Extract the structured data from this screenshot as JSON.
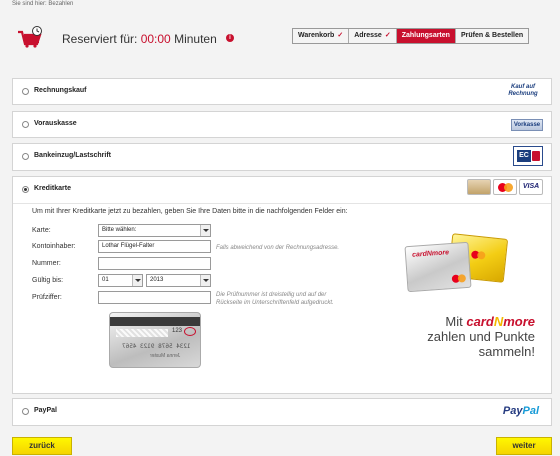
{
  "breadcrumb": "Sie sind hier: Bezahlen",
  "reservation": {
    "prefix": "Reserviert für:",
    "time": "00:00",
    "suffix": "Minuten",
    "info_symbol": "i"
  },
  "steps": [
    {
      "label": "Warenkorb",
      "check": "✓",
      "active": false
    },
    {
      "label": "Adresse",
      "check": "✓",
      "active": false
    },
    {
      "label": "Zahlungsarten",
      "check": "",
      "active": true
    },
    {
      "label": "Prüfen & Bestellen",
      "check": "",
      "active": false
    }
  ],
  "payment_options": {
    "rechnungskauf": {
      "label": "Rechnungskauf",
      "logo_line1": "Kauf auf",
      "logo_line2": "Rechnung"
    },
    "vorauskasse": {
      "label": "Vorauskasse",
      "logo": "Vorkasse"
    },
    "bankeinzug": {
      "label": "Bankeinzug/Lastschrift",
      "logo": "EC"
    },
    "kreditkarte": {
      "label": "Kreditkarte",
      "logos": [
        "",
        "MasterCard",
        "VISA"
      ]
    },
    "paypal": {
      "label": "PayPal",
      "logo_part1": "Pay",
      "logo_part2": "Pal"
    }
  },
  "creditcard_form": {
    "intro": "Um mit Ihrer Kreditkarte jetzt zu bezahlen, geben Sie Ihre Daten bitte in die nachfolgenden Felder ein:",
    "card_label": "Karte:",
    "card_value": "Bitte wählen:",
    "holder_label": "Kontoinhaber:",
    "holder_value": "Lothar Flügel-Falter",
    "holder_hint": "Falls abweichend von der Rechnungsadresse.",
    "number_label": "Nummer:",
    "number_value": "",
    "valid_label": "Gültig bis:",
    "valid_month": "01",
    "valid_year": "2013",
    "cvv_label": "Prüfziffer:",
    "cvv_value": "",
    "cvv_hint_line1": "Die Prüfnummer ist dreistellig und auf der",
    "cvv_hint_line2": "Rückseite im Unterschriftenfeld aufgedruckt."
  },
  "sample_card": {
    "cvv": "123",
    "number": "1234 5678 9123 4567",
    "name": "Jenna Muster"
  },
  "promo": {
    "card_brand": "cardNmore",
    "mit": "Mit",
    "brand_a": "card",
    "brand_n": "N",
    "brand_b": "more",
    "line2": "zahlen und Punkte",
    "line3": "sammeln!"
  },
  "buttons": {
    "back": "zurück",
    "next": "weiter"
  },
  "colors": {
    "accent_red": "#c8102e",
    "button_yellow": "#fff700"
  }
}
